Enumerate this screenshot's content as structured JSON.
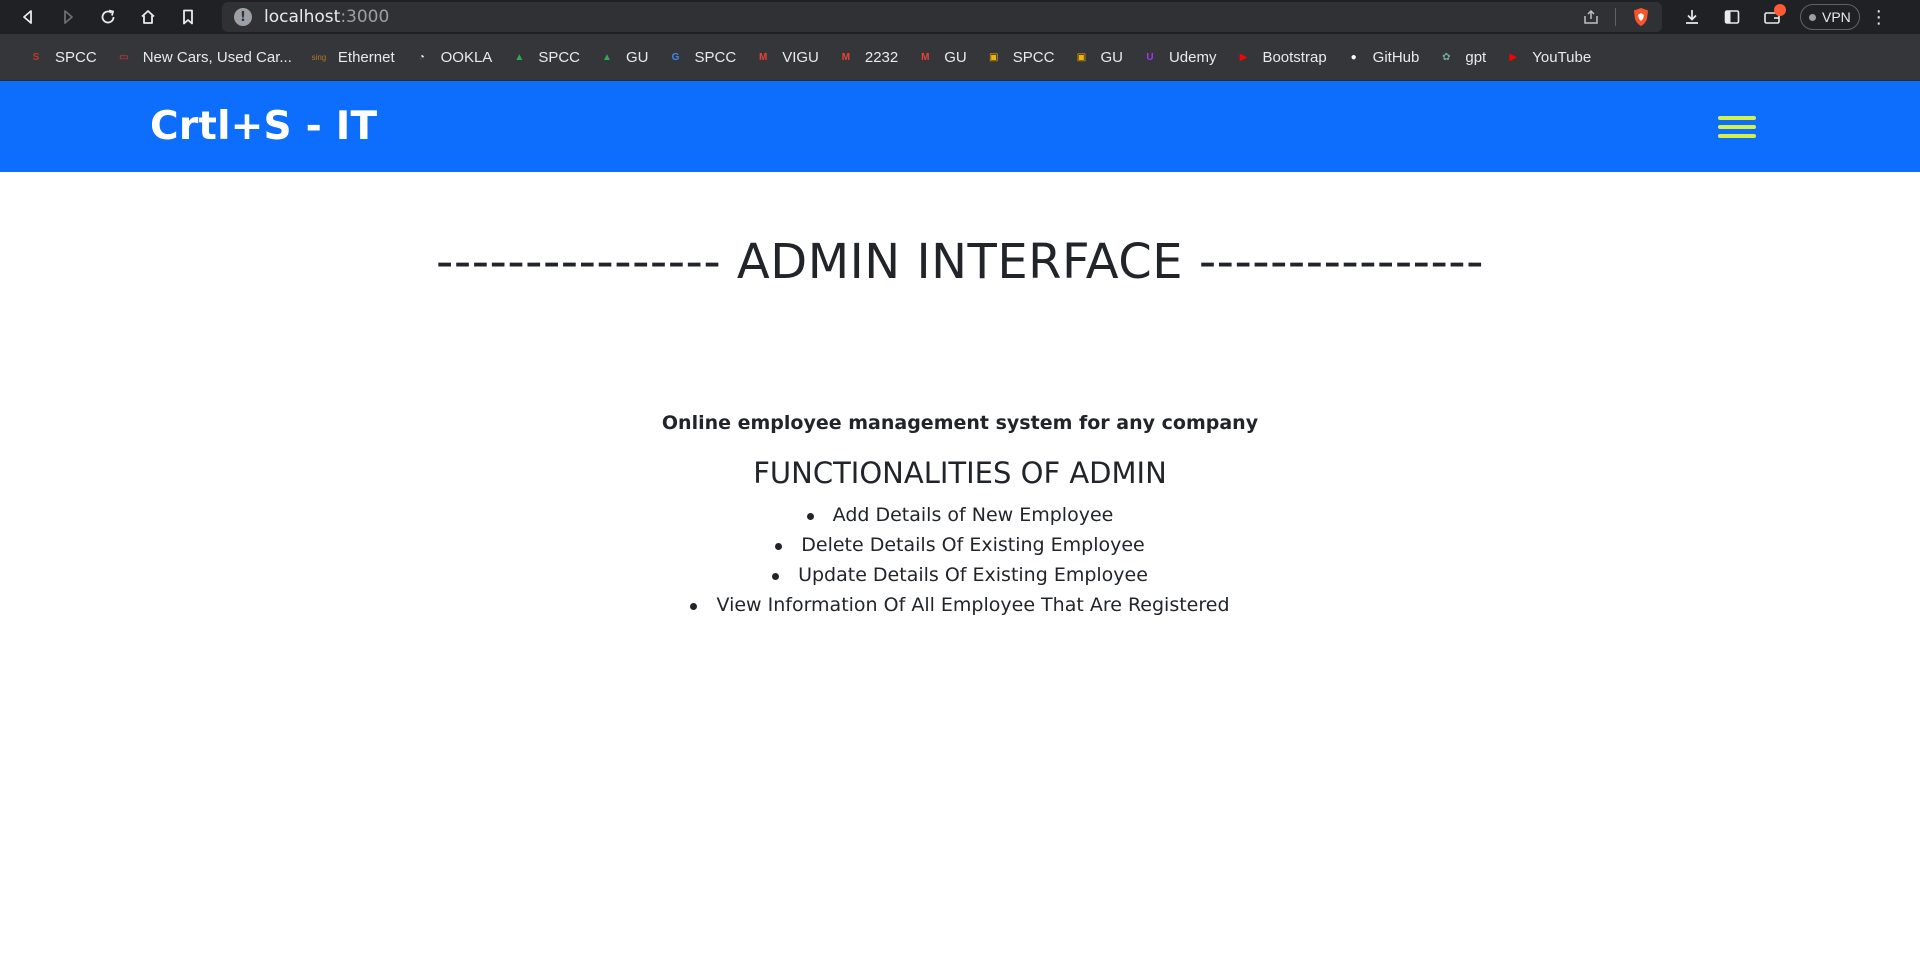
{
  "browser": {
    "url_host": "localhost",
    "url_port": ":3000",
    "vpn_label": "VPN",
    "menu_glyph": "⋮"
  },
  "bookmarks": [
    {
      "label": "SPCC",
      "icon": "spcc-logo-icon",
      "color": "#c0392b",
      "glyph": "S"
    },
    {
      "label": "New Cars, Used Car...",
      "icon": "cars-icon",
      "color": "#e53935",
      "glyph": "▭"
    },
    {
      "label": "Ethernet",
      "icon": "sing-icon",
      "color": "#b07a2a",
      "glyph": "sing"
    },
    {
      "label": "OOKLA",
      "icon": "speedtest-icon",
      "color": "#ffffff",
      "glyph": "◔"
    },
    {
      "label": "SPCC",
      "icon": "drive-icon",
      "color": "#34a853",
      "glyph": "▲"
    },
    {
      "label": "GU",
      "icon": "drive-icon",
      "color": "#34a853",
      "glyph": "▲"
    },
    {
      "label": "SPCC",
      "icon": "google-icon",
      "color": "#4285f4",
      "glyph": "G"
    },
    {
      "label": "VIGU",
      "icon": "gmail-icon",
      "color": "#ea4335",
      "glyph": "M"
    },
    {
      "label": "2232",
      "icon": "gmail-icon",
      "color": "#ea4335",
      "glyph": "M"
    },
    {
      "label": "GU",
      "icon": "gmail-icon",
      "color": "#ea4335",
      "glyph": "M"
    },
    {
      "label": "SPCC",
      "icon": "classroom-icon",
      "color": "#f4b400",
      "glyph": "▣"
    },
    {
      "label": "GU",
      "icon": "classroom-icon",
      "color": "#f4b400",
      "glyph": "▣"
    },
    {
      "label": "Udemy",
      "icon": "udemy-icon",
      "color": "#a435f0",
      "glyph": "U"
    },
    {
      "label": "Bootstrap",
      "icon": "youtube-icon",
      "color": "#ff0000",
      "glyph": "▶"
    },
    {
      "label": "GitHub",
      "icon": "github-icon",
      "color": "#ffffff",
      "glyph": "●"
    },
    {
      "label": "gpt",
      "icon": "chatgpt-icon",
      "color": "#74aa9c",
      "glyph": "✿"
    },
    {
      "label": "YouTube",
      "icon": "youtube-icon",
      "color": "#ff0000",
      "glyph": "▶"
    }
  ],
  "navbar": {
    "brand": "Crtl+S - IT",
    "bg_color": "#0d6efd",
    "toggler_color": "#d6f04a"
  },
  "main": {
    "heading": "---------------- ADMIN INTERFACE ----------------",
    "tagline": "Online employee management system for any company",
    "functions_title": "FUNCTIONALITIES OF ADMIN",
    "functions": [
      "Add Details of New Employee",
      "Delete Details Of Existing Employee",
      "Update Details Of Existing Employee",
      "View Information Of All Employee That Are Registered"
    ]
  }
}
